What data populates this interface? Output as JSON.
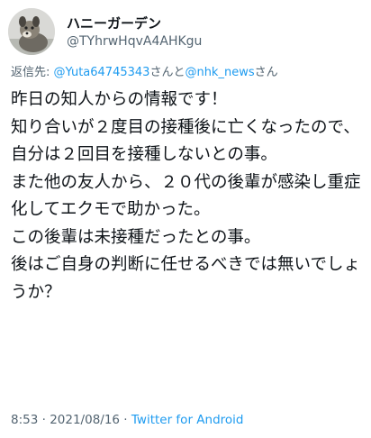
{
  "user": {
    "display_name": "ハニーガーデン",
    "handle": "@TYhrwHqvA4AHKgu"
  },
  "reply": {
    "prefix": "返信先: ",
    "mention1": "@Yuta64745343",
    "joiner": "さんと",
    "mention2": "@nhk_news",
    "suffix": "さん"
  },
  "tweet": {
    "text": "昨日の知人からの情報です！\n知り合いが２度目の接種後に亡くなったので、自分は２回目を接種しないとの事。\nまた他の友人から、２０代の後輩が感染し重症化してエクモで助かった。\nこの後輩は未接種だったとの事。\n後はご自身の判断に任せるべきでは無いでしょうか？"
  },
  "meta": {
    "time": "8:53",
    "separator1": " · ",
    "date": "2021/08/16",
    "separator2": " · ",
    "source": "Twitter for Android"
  },
  "colors": {
    "link": "#1d9bf0",
    "secondary_text": "#536471",
    "text": "#0f1419"
  }
}
